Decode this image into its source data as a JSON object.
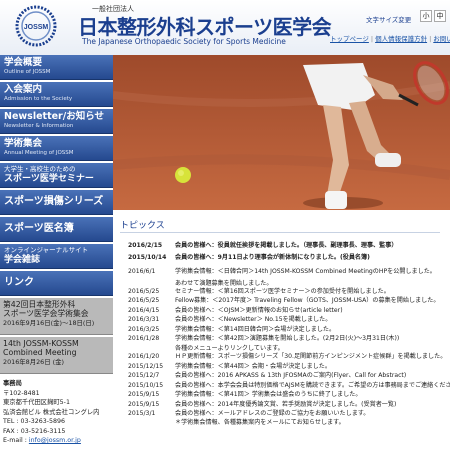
{
  "header": {
    "subtitle": "一般社団法人",
    "title": "日本整形外科スポーツ医学会",
    "title_en": "The Japanese Orthopaedic Society for Sports Medicine",
    "logo_text": "JOSSM",
    "font_size_label": "文字サイズ変更",
    "font_small": "小",
    "font_medium": "中",
    "top_links": [
      "トップページ",
      "個人情報保護方針",
      "お問い合わせ"
    ]
  },
  "sidebar": {
    "nav": [
      {
        "label": "学会概要",
        "sub": "Outline of JOSSM"
      },
      {
        "label": "入会案内",
        "sub": "Admission to the Society"
      },
      {
        "label": "Newsletter/お知らせ",
        "sub": "Newsletter & Information"
      },
      {
        "label": "学術集会",
        "sub": "Annual Meeting of JOSSM"
      },
      {
        "small": "大学生・高校生のための",
        "label": "スポーツ医学セミナー"
      },
      {
        "label": "スポーツ損傷シリーズ"
      },
      {
        "label": "スポーツ医名簿"
      },
      {
        "small": "オンラインジャーナルサイト",
        "label": "学会雑誌"
      },
      {
        "label": "リンク"
      }
    ],
    "meetings": [
      {
        "title1": "第42回日本整形外科",
        "title2": "スポーツ医学会学術集会",
        "date": "2016年9月16日(金)～18日(日)"
      },
      {
        "title1": "14th JOSSM-KOSSM",
        "title2": "Combined Meeting",
        "date": "2016年8月26日 (金)"
      }
    ],
    "office": {
      "heading": "事務局",
      "lines": [
        "〒102-8481",
        "東京都千代田区麹町5-1",
        "弘済会館ビル 株式会社コングレ内",
        "TEL : 03-3263-5896",
        "FAX : 03-5216-3115"
      ],
      "email_label": "E-mail : ",
      "email": "info@jossm.or.jp"
    }
  },
  "topics": {
    "title": "トピックス",
    "items": [
      {
        "date": "2016/2/15",
        "text": "会員の皆様へ：役員就任挨拶を掲載しました。（理事長、副理事長、理事、監事）",
        "highlight": true
      },
      {
        "date": "2015/10/14",
        "text": "会員の皆様へ：9月11日より理事会が新体制になりました。(役員名簿)",
        "highlight": true
      },
      {
        "date": "2016/6/1",
        "text": "学術集会情報：＜日韓合同＞14th JOSSM-KOSSM Combined MeetingのHPを公開しました。"
      },
      {
        "date": "",
        "text": "あわせて演題募集を開始しました。"
      },
      {
        "date": "2016/5/25",
        "text": "セミナー情報：＜第16回スポーツ医学セミナー＞の参加受付を開始しました。"
      },
      {
        "date": "2016/5/25",
        "text": "Fellow募集：＜2017年度＞ Traveling Fellow（GOTS、JOSSM-USA）の募集を開始しました。"
      },
      {
        "date": "2016/4/15",
        "text": "会員の皆様へ：＜OJSM＞更新情報のお知らせ(article letter)"
      },
      {
        "date": "2016/3/31",
        "text": "会員の皆様へ：＜Newsletter＞ No.15を掲載しました。"
      },
      {
        "date": "2016/3/25",
        "text": "学術集会情報：＜第14回日韓合同＞会場が決定しました。"
      },
      {
        "date": "2016/1/28",
        "text": "学術集会情報：＜第42回＞演題募集を開始しました。(2月2日(火)～3月31日(木))"
      },
      {
        "date": "",
        "text": "各種のメニューよりリンクしています。"
      },
      {
        "date": "2016/1/20",
        "text": "ＨＰ更新情報：スポーツ損傷シリーズ「30.足関節前方インピンジメント症候群」を掲載しました。"
      },
      {
        "date": "2015/12/15",
        "text": "学術集会情報：＜第44回＞ 会期・会場が決定しました。"
      },
      {
        "date": "2015/12/7",
        "text": "会員の皆様へ：2016 APKASS & 13th JFOSMAのご案内(Flyer、Call for Abstract)"
      },
      {
        "date": "2015/10/15",
        "text": "会員の皆様へ：本学会会員は特別価格でAJSMを購読できます。ご希望の方は事務局までご連絡ください。"
      },
      {
        "date": "2015/9/15",
        "text": "学術集会情報：＜第41回＞ 学術集会は盛会のうちに終了しました。"
      },
      {
        "date": "2015/9/15",
        "text": "会員の皆様へ：2014年度優秀論文賞、若手奨励賞が決定しました。(受賞者一覧)"
      },
      {
        "date": "2015/3/1",
        "text": "会員の皆様へ：メールアドレスのご登録のご協力をお願いいたします。"
      },
      {
        "date": "",
        "text": "＊学術集会情報、各種募集案内をメールにてお知らせします。"
      }
    ]
  },
  "colors": {
    "nav_blue": "#2f58a3",
    "title_blue": "#1b3f8f",
    "link": "#1a53a6",
    "clay": "#b85a35"
  }
}
